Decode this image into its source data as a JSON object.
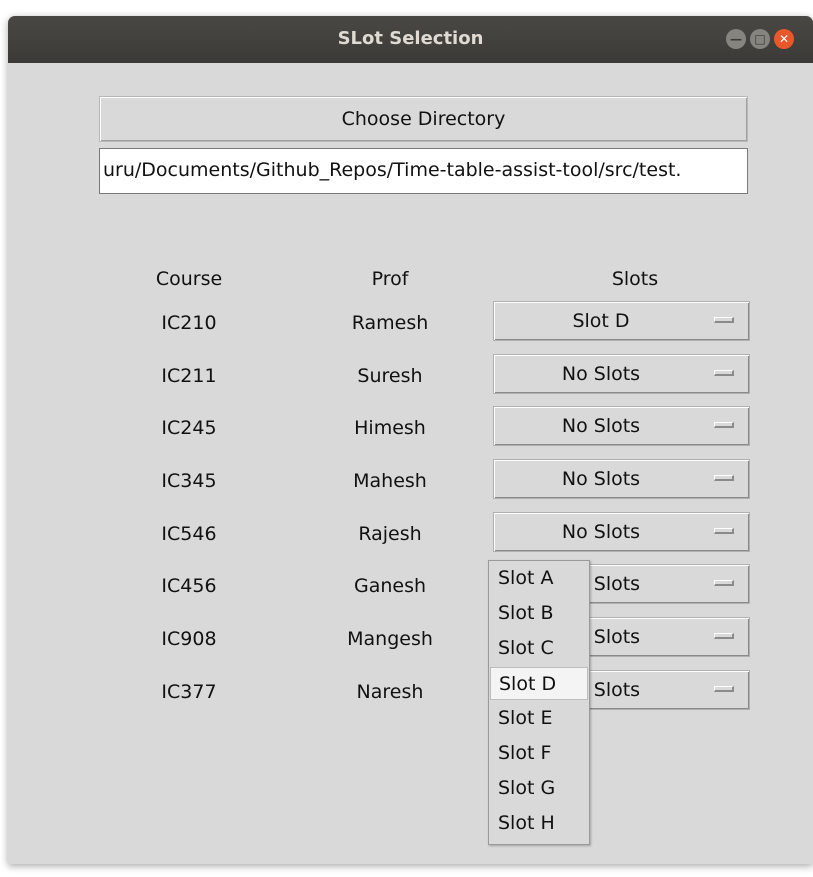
{
  "window": {
    "title": "SLot Selection"
  },
  "directory": {
    "choose_label": "Choose Directory",
    "path_value": "uru/Documents/Github_Repos/Time-table-assist-tool/src/test."
  },
  "table": {
    "headers": {
      "course": "Course",
      "prof": "Prof",
      "slots": "Slots"
    },
    "rows": [
      {
        "course": "IC210",
        "prof": "Ramesh",
        "slot": "Slot D"
      },
      {
        "course": "IC211",
        "prof": "Suresh",
        "slot": "No Slots"
      },
      {
        "course": "IC245",
        "prof": "Himesh",
        "slot": "No Slots"
      },
      {
        "course": "IC345",
        "prof": "Mahesh",
        "slot": "No Slots"
      },
      {
        "course": "IC546",
        "prof": "Rajesh",
        "slot": "No Slots"
      },
      {
        "course": "IC456",
        "prof": "Ganesh",
        "slot": "No Slots"
      },
      {
        "course": "IC908",
        "prof": "Mangesh",
        "slot": "No Slots"
      },
      {
        "course": "IC377",
        "prof": "Naresh",
        "slot": "No Slots"
      }
    ]
  },
  "dropdown": {
    "options": [
      "Slot A",
      "Slot B",
      "Slot C",
      "Slot D",
      "Slot E",
      "Slot F",
      "Slot G",
      "Slot H"
    ],
    "highlighted": "Slot D"
  },
  "icons": {
    "minimize": "minimize-icon",
    "maximize": "maximize-icon",
    "close": "close-icon"
  },
  "colors": {
    "titlebar": "#3b3a36",
    "window_bg": "#d9d9d9",
    "close_button": "#e8582a"
  }
}
